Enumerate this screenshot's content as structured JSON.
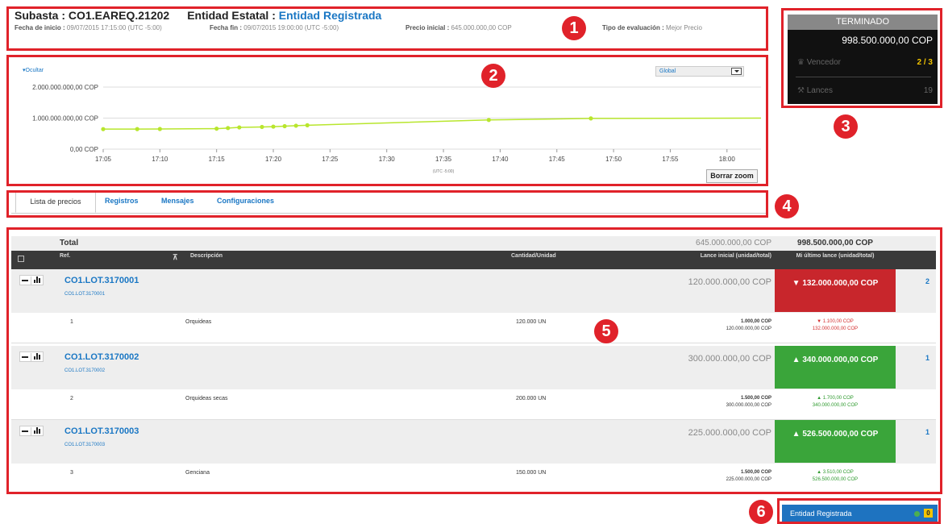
{
  "header": {
    "auction_label": "Subasta : CO1.EAREQ.21202",
    "entity_label": "Entidad Estatal :",
    "entity_value": "Entidad Registrada",
    "start_label": "Fecha de inicio :",
    "start_value": "09/07/2015 17:15:00 (UTC -5:00)",
    "end_label": "Fecha fin :",
    "end_value": "09/07/2015 19:00:00 (UTC -5:00)",
    "price_label": "Precio inicial :",
    "price_value": "645.000.000,00 COP",
    "eval_label": "Tipo de evaluación :",
    "eval_value": "Mejor Precio"
  },
  "chart": {
    "toggle_label": "▾Ocultar",
    "select_value": "Global",
    "zoom_reset_label": "Borrar zoom",
    "x_note": "(UTC -5:00)"
  },
  "chart_data": {
    "type": "line",
    "y_ticks": [
      "2.000.000.000,00 COP",
      "1.000.000.000,00 COP",
      "0,00 COP"
    ],
    "y_values": [
      2000000000,
      1000000000,
      0
    ],
    "x_ticks": [
      "17:05",
      "17:10",
      "17:15",
      "17:20",
      "17:25",
      "17:30",
      "17:35",
      "17:40",
      "17:45",
      "17:50",
      "17:55",
      "18:00"
    ],
    "ylim": [
      0,
      2000000000
    ],
    "series_color": "#b8e62d",
    "points": [
      {
        "x": "17:05",
        "y": 645000000
      },
      {
        "x": "17:08",
        "y": 646000000
      },
      {
        "x": "17:10",
        "y": 650000000
      },
      {
        "x": "17:15",
        "y": 660000000
      },
      {
        "x": "17:16",
        "y": 680000000
      },
      {
        "x": "17:17",
        "y": 700000000
      },
      {
        "x": "17:19",
        "y": 715000000
      },
      {
        "x": "17:20",
        "y": 725000000
      },
      {
        "x": "17:21",
        "y": 740000000
      },
      {
        "x": "17:22",
        "y": 755000000
      },
      {
        "x": "17:23",
        "y": 770000000
      },
      {
        "x": "17:39",
        "y": 940000000
      },
      {
        "x": "17:48",
        "y": 990000000
      },
      {
        "x": "18:03",
        "y": 998500000
      }
    ]
  },
  "status": {
    "state": "TERMINADO",
    "amount": "998.500.000,00 COP",
    "winner_label": "Vencedor",
    "winner_value": "2 / 3",
    "bids_label": "Lances",
    "bids_value": "19"
  },
  "tabs": [
    {
      "label": "Lista de precios"
    },
    {
      "label": "Registros"
    },
    {
      "label": "Mensajes"
    },
    {
      "label": "Configuraciones"
    }
  ],
  "table": {
    "total_label": "Total",
    "total_initial": "645.000.000,00 COP",
    "total_last": "998.500.000,00 COP",
    "col_ref": "Ref.",
    "col_desc": "Descripción",
    "col_qty": "Cantidad/Unidad",
    "col_init": "Lance inicial (unidad/total)",
    "col_last": "Mi último lance (unidad/total)",
    "lots": [
      {
        "ref": "CO1.LOT.3170001",
        "sub": "CO1.LOT.3170001",
        "initial": "120.000.000,00 COP",
        "bid": "▼ 132.000.000,00 COP",
        "bid_color": "#c8262c",
        "count": "2",
        "item": {
          "num": "1",
          "desc": "Orquideas",
          "qty": "120.000 UN",
          "init_unit": "1.000,00 COP",
          "init_total": "120.000.000,00 COP",
          "bid_unit": "▼ 1.100,00 COP",
          "bid_total": "132.000.000,00 COP",
          "bid_text_color": "#d32f2f"
        }
      },
      {
        "ref": "CO1.LOT.3170002",
        "sub": "CO1.LOT.3170002",
        "initial": "300.000.000,00 COP",
        "bid": "▲ 340.000.000,00 COP",
        "bid_color": "#3aa53a",
        "count": "1",
        "item": {
          "num": "2",
          "desc": "Orquideas secas",
          "qty": "200.000 UN",
          "init_unit": "1.500,00 COP",
          "init_total": "300.000.000,00 COP",
          "bid_unit": "▲ 1.700,00 COP",
          "bid_total": "340.000.000,00 COP",
          "bid_text_color": "#2e9a2e"
        }
      },
      {
        "ref": "CO1.LOT.3170003",
        "sub": "CO1.LOT.3170003",
        "initial": "225.000.000,00 COP",
        "bid": "▲ 526.500.000,00 COP",
        "bid_color": "#3aa53a",
        "count": "1",
        "item": {
          "num": "3",
          "desc": "Genciana",
          "qty": "150.000 UN",
          "init_unit": "1.500,00 COP",
          "init_total": "225.000.000,00 COP",
          "bid_unit": "▲ 3.510,00 COP",
          "bid_total": "526.500.000,00 COP",
          "bid_text_color": "#2e9a2e"
        }
      }
    ]
  },
  "footer": {
    "entity": "Entidad Registrada",
    "count": "0"
  },
  "callouts": [
    "1",
    "2",
    "3",
    "4",
    "5",
    "6"
  ],
  "accent_colors": {
    "link": "#1a77c4",
    "callout": "#e0222a",
    "loss": "#c8262c",
    "gain": "#3aa53a"
  }
}
